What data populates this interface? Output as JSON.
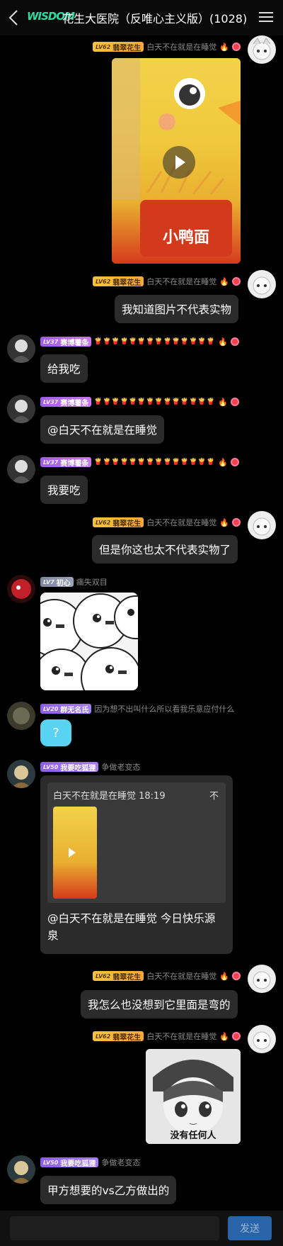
{
  "header": {
    "logo_text": "WISDOM",
    "title": "花生大医院（反唯心主义版）(1028)"
  },
  "users": {
    "me": {
      "level": "LV62",
      "tag": "翡翠花生",
      "name": "白天不在就是在睡觉"
    },
    "saibo": {
      "level": "LV37",
      "tag": "赛博薯条"
    },
    "chuxin": {
      "level": "LV7",
      "tag": "初心",
      "name": "痛失双目"
    },
    "qunwu": {
      "level": "LV20",
      "tag": "群无名氏",
      "name": "因为想不出叫什么所以看我乐意应付什么"
    },
    "woyao": {
      "level": "LV50",
      "tag": "我要吃狐狸",
      "name": "争做老变态"
    }
  },
  "messages": {
    "m1_bubble": "我知道图片不代表实物",
    "m2_bubble": "给我吃",
    "m3_bubble": "@白天不在就是在睡觉",
    "m4_bubble": "我要吃",
    "m5_bubble": "但是你这也太不代表实物了",
    "m7_bubble": "?",
    "m8_quote_head": "白天不在就是在睡觉 18:19",
    "m8_quote_close": "不",
    "m8_text": "@白天不在就是在睡觉 今日快乐源泉",
    "m9_bubble": "我怎么也没想到它里面是弯的",
    "m10_caption": "没有任何人",
    "m11_bubble": "甲方想要的vs乙方做出的"
  },
  "video": {
    "package_text": "小鸭面"
  },
  "footer": {
    "send_label": "发送"
  },
  "colors": {
    "background": "#000000",
    "bubble": "#2b2b2b",
    "send": "#2a64a8",
    "logo": "#2ed9a3"
  }
}
